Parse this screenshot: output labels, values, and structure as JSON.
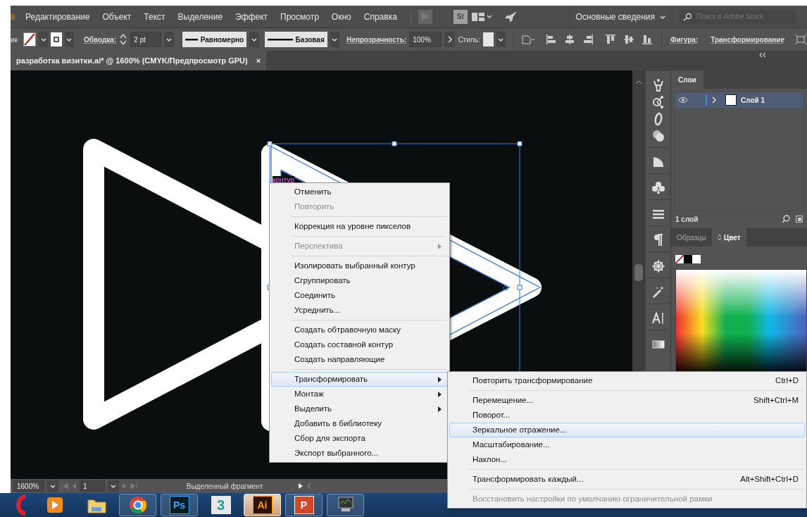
{
  "menu_bar": {
    "items": [
      "Редактирование",
      "Объект",
      "Текст",
      "Выделение",
      "Эффект",
      "Просмотр",
      "Окно",
      "Справка"
    ],
    "app_buttons": [
      "Br",
      "St"
    ],
    "workspace": "Основные сведения",
    "search": {
      "placeholder": "Поиск в Adobe Stock"
    }
  },
  "control_bar": {
    "cut_label": "ик",
    "stroke_label": "Обводка:",
    "stroke_weight": "2 pt",
    "profile": "Равномерно",
    "brush": "Базовая",
    "opacity_label": "Непрозрачность:",
    "opacity": "100%",
    "style_label": "Стиль:",
    "shape_label": "Фигура:",
    "transform_label": "Трансформирование"
  },
  "document_tab": {
    "title": "разработка визитки.ai* @ 1600% (CMYK/Предпросмотр GPU)",
    "close": "×"
  },
  "canvas": {
    "path_label": "контур"
  },
  "context_menu": {
    "groups": [
      [
        {
          "label": "Отменить",
          "disabled": false,
          "submenu": false,
          "selected": false
        },
        {
          "label": "Повторить",
          "disabled": true,
          "submenu": false,
          "selected": false
        }
      ],
      [
        {
          "label": "Коррекция на уровне пикселов",
          "disabled": false,
          "submenu": false,
          "selected": false
        }
      ],
      [
        {
          "label": "Перспектива",
          "disabled": true,
          "submenu": true,
          "selected": false
        }
      ],
      [
        {
          "label": "Изолировать выбранный контур",
          "disabled": false,
          "submenu": false,
          "selected": false
        },
        {
          "label": "Сгруппировать",
          "disabled": false,
          "submenu": false,
          "selected": false
        },
        {
          "label": "Соединить",
          "disabled": false,
          "submenu": false,
          "selected": false
        },
        {
          "label": "Усреднить...",
          "disabled": false,
          "submenu": false,
          "selected": false
        }
      ],
      [
        {
          "label": "Создать обтравочную маску",
          "disabled": false,
          "submenu": false,
          "selected": false
        },
        {
          "label": "Создать составной контур",
          "disabled": false,
          "submenu": false,
          "selected": false
        },
        {
          "label": "Создать направляющие",
          "disabled": false,
          "submenu": false,
          "selected": false
        }
      ],
      [
        {
          "label": "Трансформировать",
          "disabled": false,
          "submenu": true,
          "selected": true
        },
        {
          "label": "Монтаж",
          "disabled": false,
          "submenu": true,
          "selected": false
        },
        {
          "label": "Выделить",
          "disabled": false,
          "submenu": true,
          "selected": false
        },
        {
          "label": "Добавить в библиотеку",
          "disabled": false,
          "submenu": false,
          "selected": false
        },
        {
          "label": "Сбор для экспорта",
          "disabled": false,
          "submenu": false,
          "selected": false
        },
        {
          "label": "Экспорт выбранного...",
          "disabled": false,
          "submenu": false,
          "selected": false
        }
      ]
    ]
  },
  "submenu": {
    "groups": [
      [
        {
          "label": "Повторить трансформирование",
          "shortcut": "Ctrl+D",
          "disabled": false,
          "selected": false
        }
      ],
      [
        {
          "label": "Перемещение...",
          "shortcut": "Shift+Ctrl+M",
          "disabled": false,
          "selected": false
        },
        {
          "label": "Поворот...",
          "disabled": false,
          "selected": false
        },
        {
          "label": "Зеркальное отражение...",
          "disabled": false,
          "selected": true
        },
        {
          "label": "Масштабирование...",
          "disabled": false,
          "selected": false
        },
        {
          "label": "Наклон...",
          "disabled": false,
          "selected": false
        }
      ],
      [
        {
          "label": "Трансформировать каждый...",
          "shortcut": "Alt+Shift+Ctrl+D",
          "disabled": false,
          "selected": false
        }
      ],
      [
        {
          "label": "Восстановить настройки по умолчанию ограничительной рамки",
          "disabled": true,
          "selected": false
        }
      ]
    ]
  },
  "layers_panel": {
    "tab": "Слои",
    "layers": [
      {
        "name": "Слой 1",
        "visible": true,
        "selected": true
      }
    ],
    "count": "1 слой"
  },
  "color_panel": {
    "tabs": [
      {
        "label": "Образцы",
        "selected": false
      },
      {
        "label": "Цвет",
        "selected": true
      }
    ]
  },
  "status_bar": {
    "zoom": "1600%",
    "artboard": "1",
    "status": "Выделенный фрагмент"
  },
  "taskbar": {
    "apps": [
      {
        "kind": "opera",
        "running": false,
        "selected": false
      },
      {
        "kind": "player",
        "running": false,
        "selected": false
      },
      {
        "kind": "folder",
        "running": false,
        "selected": false
      },
      {
        "kind": "chrome",
        "running": true,
        "selected": false
      },
      {
        "kind": "ps",
        "label": "Ps",
        "running": true,
        "selected": false
      },
      {
        "kind": "max",
        "label": "3",
        "running": false,
        "selected": false
      },
      {
        "kind": "ai",
        "label": "Ai",
        "running": true,
        "selected": true
      },
      {
        "kind": "ppt",
        "label": "P",
        "running": true,
        "selected": false
      },
      {
        "kind": "monitor",
        "running": true,
        "selected": false
      }
    ]
  }
}
